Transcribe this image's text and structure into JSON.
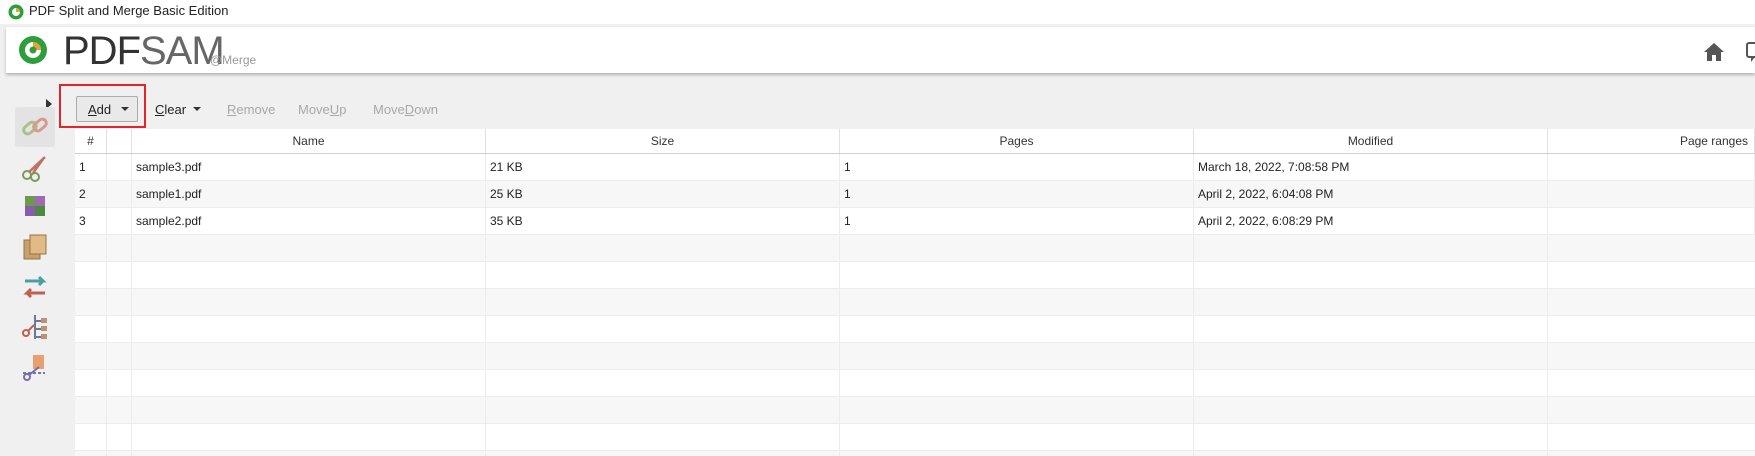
{
  "window": {
    "title": "PDF Split and Merge Basic Edition"
  },
  "banner": {
    "wordmark_a": "PDF",
    "wordmark_b": "SAM",
    "subtitle": "@Merge"
  },
  "toolbar": {
    "add_prefix": "A",
    "add_rest": "dd",
    "clear_prefix": "C",
    "clear_rest": "lear",
    "remove_prefix": "R",
    "remove_rest": "emove",
    "moveup_a": "Move ",
    "moveup_b": "U",
    "moveup_c": "p",
    "movedown_a": "Move ",
    "movedown_b": "D",
    "movedown_c": "own"
  },
  "table": {
    "columns": [
      "#",
      "Name",
      "Size",
      "Pages",
      "Modified",
      "Page ranges"
    ],
    "rows": [
      {
        "num": "1",
        "name": "sample3.pdf",
        "size": "21 KB",
        "pages": "1",
        "modified": "March 18, 2022, 7:08:58 PM",
        "ranges": ""
      },
      {
        "num": "2",
        "name": "sample1.pdf",
        "size": "25 KB",
        "pages": "1",
        "modified": "April 2, 2022, 6:04:08 PM",
        "ranges": ""
      },
      {
        "num": "3",
        "name": "sample2.pdf",
        "size": "35 KB",
        "pages": "1",
        "modified": "April 2, 2022, 6:08:29 PM",
        "ranges": ""
      }
    ]
  },
  "colors": {
    "highlight": "#e0262b",
    "brand_green": "#2e9e3a"
  },
  "sidebar": {
    "tools": [
      "merge-tool-icon",
      "split-tool-icon",
      "split-by-bookmarks-icon",
      "extract-pages-icon",
      "rotate-tool-icon",
      "split-by-size-icon",
      "alternate-mix-icon"
    ]
  }
}
